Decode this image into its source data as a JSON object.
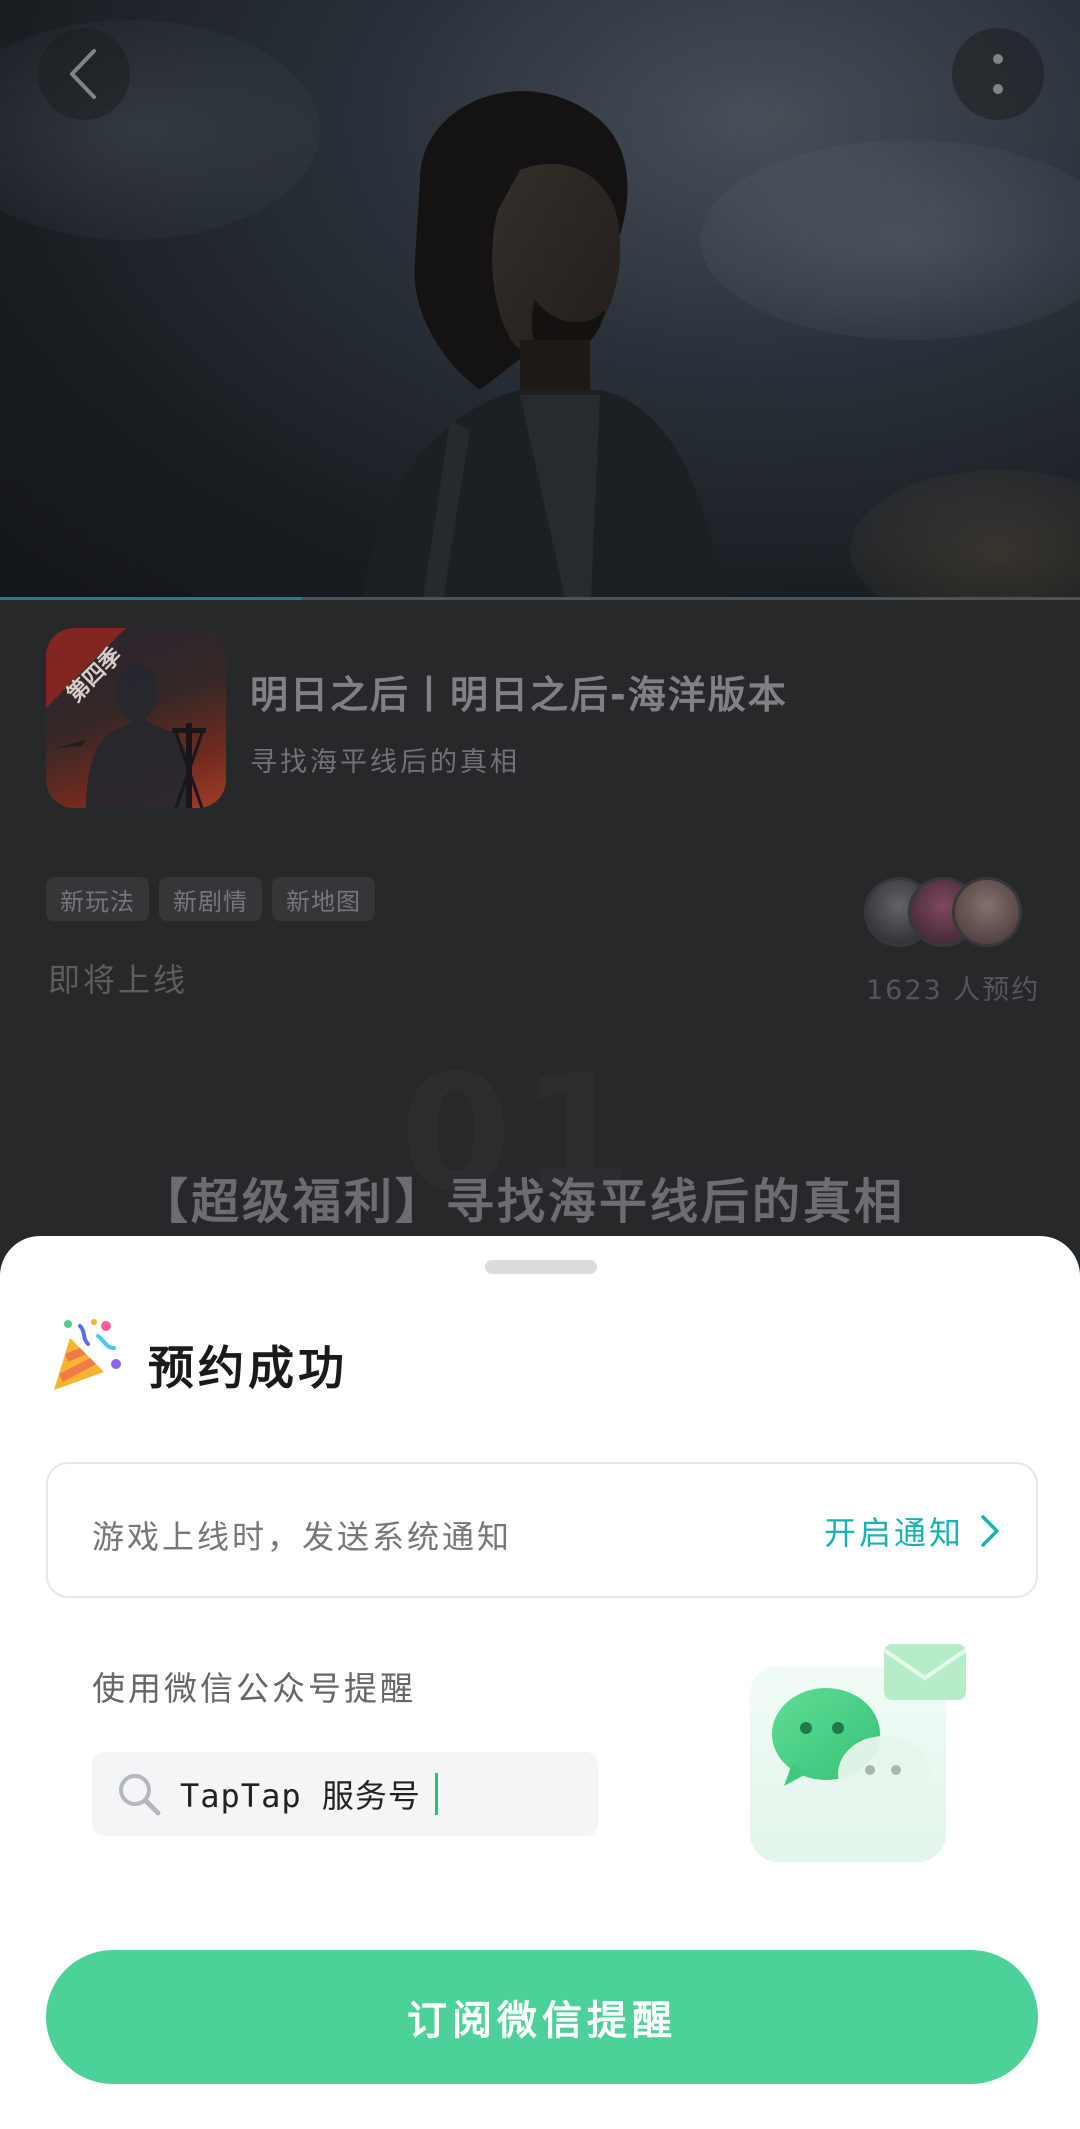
{
  "hero": {
    "video_progress_fraction": 0.28
  },
  "nav": {
    "back_icon": "chevron-left-icon",
    "more_icon": "more-vertical-icon"
  },
  "game": {
    "title": "明日之后丨明日之后-海洋版本",
    "subtitle": "寻找海平线后的真相",
    "icon_badge": "第四季",
    "tags": [
      "新玩法",
      "新剧情",
      "新地图"
    ],
    "status": "即将上线",
    "reserve_count": "1623 人预约"
  },
  "promo": {
    "number": "01",
    "title": "【超级福利】寻找海平线后的真相"
  },
  "sheet": {
    "title": "预约成功",
    "notify_text": "游戏上线时，发送系统通知",
    "notify_link": "开启通知",
    "wechat_label": "使用微信公众号提醒",
    "search_value": "TapTap 服务号",
    "subscribe_button": "订阅微信提醒"
  },
  "colors": {
    "accent_teal": "#17b3b3",
    "button_green": "#4cd299",
    "cursor_green": "#27c07d"
  }
}
